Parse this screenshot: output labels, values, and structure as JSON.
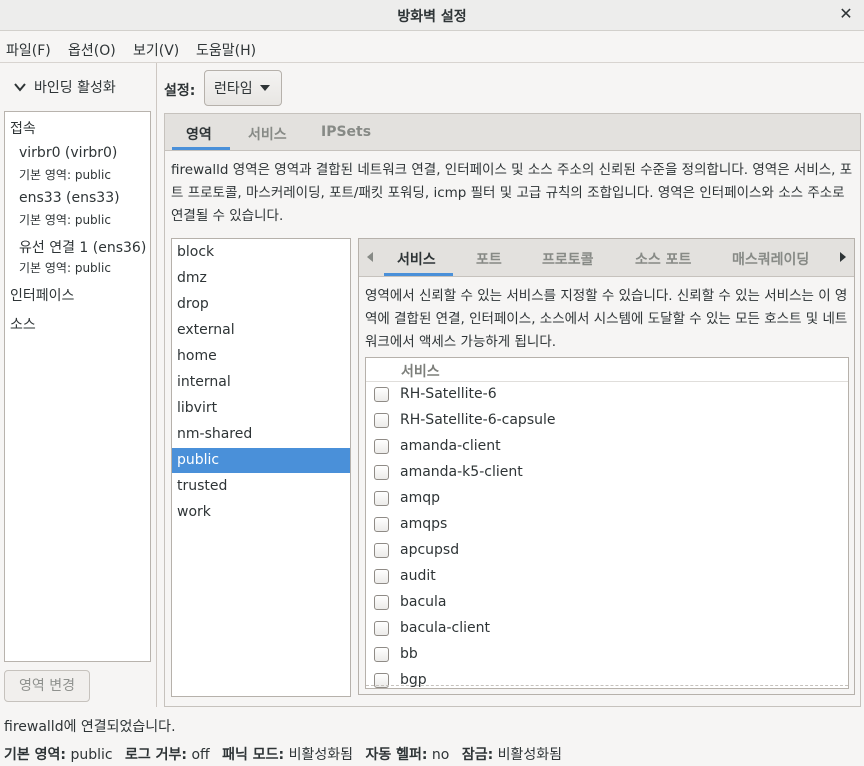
{
  "window": {
    "title": "방화벽 설정"
  },
  "menu": [
    "파일(F)",
    "옵션(O)",
    "보기(V)",
    "도움말(H)"
  ],
  "left": {
    "binding_toggle": "바인딩 활성화",
    "connections_heading": "접속",
    "connections": [
      {
        "name": "virbr0 (virbr0)",
        "zone": "기본 영역: public"
      },
      {
        "name": "ens33 (ens33)",
        "zone": "기본 영역: public"
      },
      {
        "name": "유선 연결 1 (ens36)",
        "zone": "기본 영역: public"
      }
    ],
    "interfaces_heading": "인터페이스",
    "sources_heading": "소스",
    "change_zone_button": "영역 변경"
  },
  "config": {
    "label": "설정:",
    "value": "런타임"
  },
  "main_tabs": [
    "영역",
    "서비스",
    "IPSets"
  ],
  "zone_description": "firewalld 영역은 영역과 결합된 네트워크 연결, 인터페이스 및 소스 주소의 신뢰된 수준을 정의합니다. 영역은 서비스, 포트 프로토콜, 마스커레이딩, 포트/패킷 포워딩, icmp 필터 및 고급 규칙의 조합입니다. 영역은 인터페이스와 소스 주소로 연결될 수 있습니다.",
  "zones": [
    "block",
    "dmz",
    "drop",
    "external",
    "home",
    "internal",
    "libvirt",
    "nm-shared",
    "public",
    "trusted",
    "work"
  ],
  "selected_zone": "public",
  "sub_tabs": [
    "서비스",
    "포트",
    "프로토콜",
    "소스 포트",
    "매스쿼레이딩"
  ],
  "services_description": "영역에서 신뢰할 수 있는 서비스를 지정할 수 있습니다. 신뢰할 수 있는 서비스는 이 영역에 결합된 연결, 인터페이스, 소스에서 시스템에 도달할 수 있는 모든 호스트 및 네트워크에서 액세스 가능하게 됩니다.",
  "services_column": "서비스",
  "services": [
    {
      "name": "RH-Satellite-6",
      "checked": false
    },
    {
      "name": "RH-Satellite-6-capsule",
      "checked": false
    },
    {
      "name": "amanda-client",
      "checked": false
    },
    {
      "name": "amanda-k5-client",
      "checked": false
    },
    {
      "name": "amqp",
      "checked": false
    },
    {
      "name": "amqps",
      "checked": false
    },
    {
      "name": "apcupsd",
      "checked": false
    },
    {
      "name": "audit",
      "checked": false
    },
    {
      "name": "bacula",
      "checked": false
    },
    {
      "name": "bacula-client",
      "checked": false
    },
    {
      "name": "bb",
      "checked": false
    },
    {
      "name": "bgp",
      "checked": false
    }
  ],
  "status": {
    "connection": "firewalld에 연결되었습니다.",
    "default_zone_label": "기본 영역:",
    "default_zone": "public",
    "log_denied_label": "로그 거부:",
    "log_denied": "off",
    "panic_label": "패닉 모드:",
    "panic": "비활성화됨",
    "helpers_label": "자동 헬퍼:",
    "helpers": "no",
    "lockdown_label": "잠금:",
    "lockdown": "비활성화됨"
  },
  "colors": {
    "accent": "#4a90d9",
    "selection_text": "#ffffff"
  }
}
